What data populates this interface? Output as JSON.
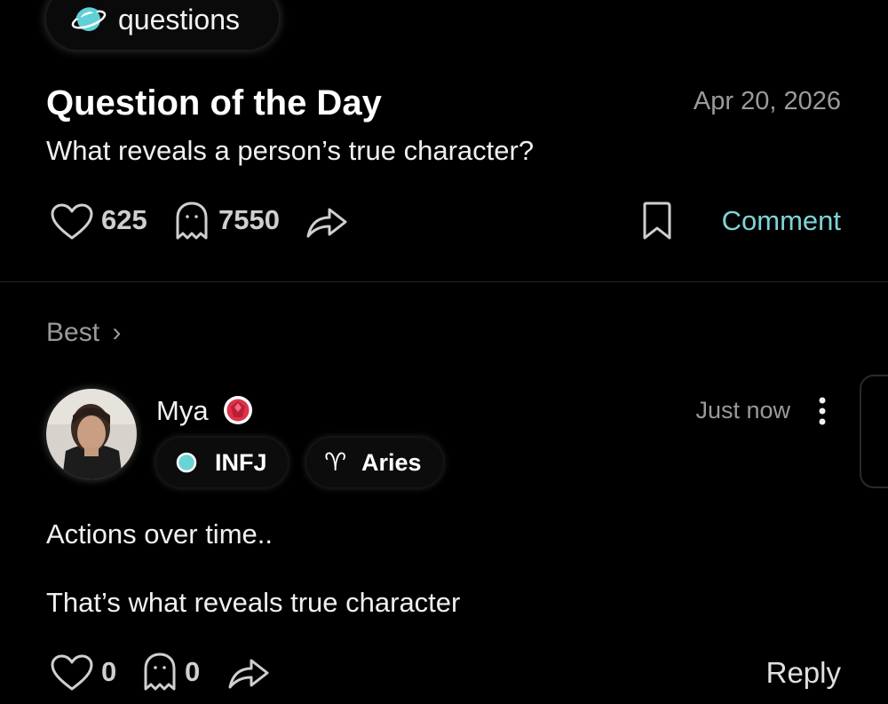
{
  "topic": {
    "label": "questions",
    "icon": "planet-icon",
    "icon_color": "#5fd0d6"
  },
  "question": {
    "title": "Question of the Day",
    "date": "Apr 20, 2026",
    "body": "What reveals a person’s true character?",
    "likes": "625",
    "ghosts": "7550",
    "comment_label": "Comment"
  },
  "sort": {
    "label": "Best",
    "chevron": "›"
  },
  "comment": {
    "username": "Mya",
    "badge_icon": "ruby-gem-icon",
    "badge_color": "#e0314b",
    "personality": {
      "label": "INFJ",
      "dot_color": "#6ad3d3"
    },
    "zodiac": {
      "label": "Aries",
      "glyph": "♈"
    },
    "time": "Just now",
    "text_line1": "Actions over time..",
    "text_line2": "That’s what reveals true character",
    "likes": "0",
    "ghosts": "0",
    "reply_label": "Reply"
  },
  "accent_color": "#7fd3d6"
}
